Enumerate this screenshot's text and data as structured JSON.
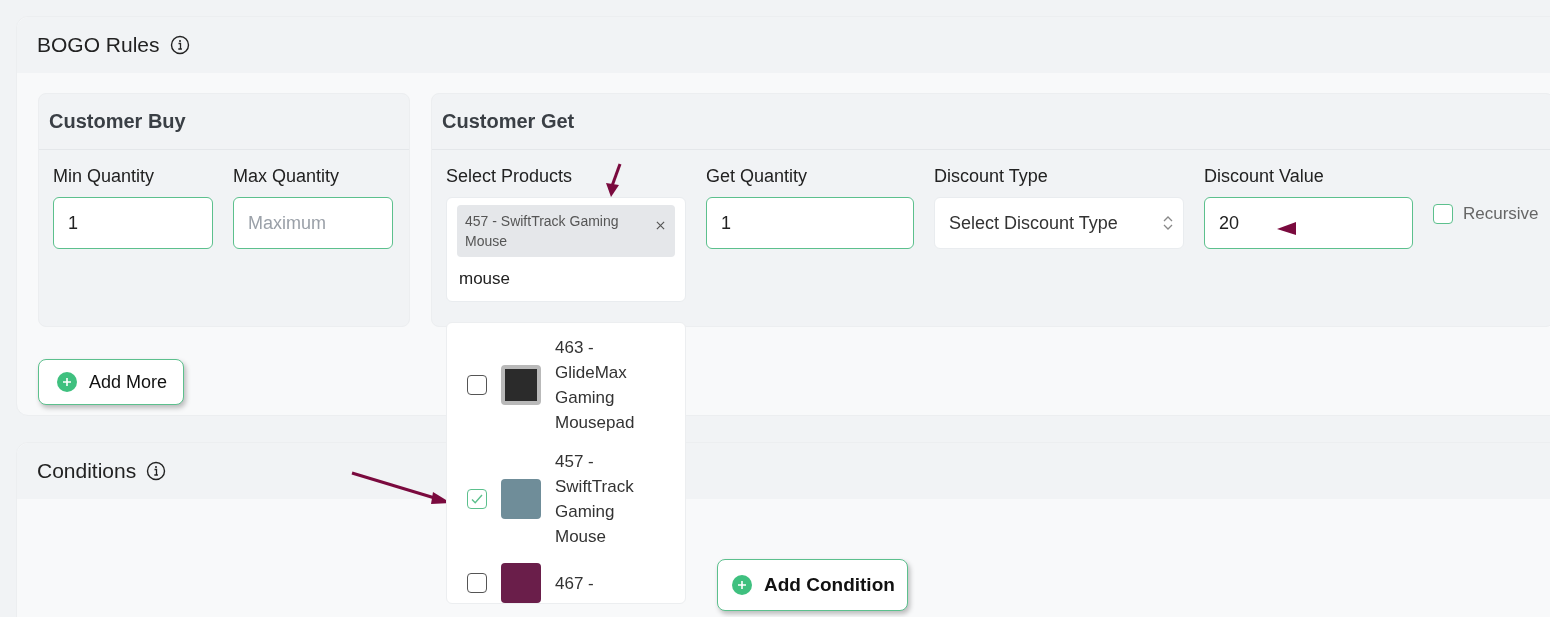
{
  "bogo_rules": {
    "title": "BOGO Rules",
    "customer_buy": {
      "title": "Customer Buy",
      "fields": [
        {
          "label": "Min Quantity",
          "value": "1"
        },
        {
          "label": "Max Quantity",
          "placeholder": "Maximum"
        }
      ]
    },
    "customer_get": {
      "title": "Customer Get",
      "select_products": {
        "label": "Select Products",
        "tags": [
          "457 - SwiftTrack Gaming Mouse"
        ],
        "search_value": "mouse",
        "options": [
          {
            "label": "463 - GlideMax Gaming Mousepad",
            "checked": false
          },
          {
            "label": "457 - SwiftTrack Gaming Mouse",
            "checked": true
          },
          {
            "label": "467 -",
            "checked": false
          }
        ]
      },
      "get_quantity": {
        "label": "Get Quantity",
        "value": "1"
      },
      "discount_type": {
        "label": "Discount Type",
        "placeholder": "Select Discount Type"
      },
      "discount_value": {
        "label": "Discount Value",
        "value": "20"
      },
      "recursive": {
        "label": "Recursive",
        "checked": false
      }
    },
    "add_more_button": "Add More"
  },
  "conditions": {
    "title": "Conditions",
    "add_condition_button": "Add Condition"
  }
}
